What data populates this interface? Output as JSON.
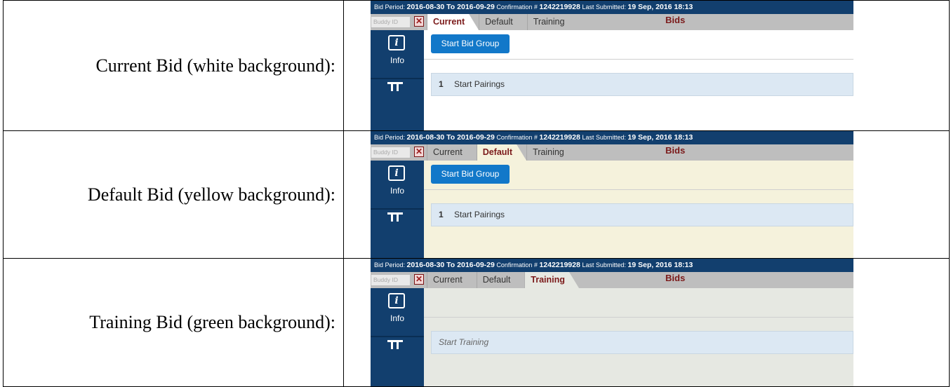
{
  "colors": {
    "header_bg": "#123f6e",
    "current_bg": "#ffffff",
    "default_bg": "#f5f2dc",
    "training_bg": "#e6e8e2",
    "button_blue": "#1278c9",
    "active_tab_text": "#7b1a1a"
  },
  "rows": [
    {
      "label": "Current Bid (white background):",
      "screenshot": {
        "bid_period_label": "Bid Period:",
        "bid_period_value": "2016-08-30 To 2016-09-29",
        "confirmation_label": "Confirmation #",
        "confirmation_value": "1242219928",
        "last_submitted_label": "Last Submitted:",
        "last_submitted_value": "19 Sep, 2016 18:13",
        "buddy_placeholder": "Buddy ID",
        "buddy_close": "✕",
        "tabs": [
          "Current",
          "Default",
          "Training"
        ],
        "active_tab": 0,
        "title": "Bids",
        "sidebar_icon": "info-icon",
        "sidebar_info_glyph": "i",
        "sidebar_info_label": "Info",
        "sidebar_icon2": "bid-list-icon",
        "button_label": "Start Bid Group",
        "list_number": "1",
        "list_text": "Start Pairings"
      }
    },
    {
      "label": "Default Bid (yellow background):",
      "screenshot": {
        "bid_period_label": "Bid Period:",
        "bid_period_value": "2016-08-30 To 2016-09-29",
        "confirmation_label": "Confirmation #",
        "confirmation_value": "1242219928",
        "last_submitted_label": "Last Submitted:",
        "last_submitted_value": "19 Sep, 2016 18:13",
        "buddy_placeholder": "Buddy ID",
        "buddy_close": "✕",
        "tabs": [
          "Current",
          "Default",
          "Training"
        ],
        "active_tab": 1,
        "title": "Bids",
        "sidebar_icon": "info-icon",
        "sidebar_info_glyph": "i",
        "sidebar_info_label": "Info",
        "sidebar_icon2": "bid-list-icon",
        "button_label": "Start Bid Group",
        "list_number": "1",
        "list_text": "Start Pairings"
      }
    },
    {
      "label": "Training Bid (green background):",
      "screenshot": {
        "bid_period_label": "Bid Period:",
        "bid_period_value": "2016-08-30 To 2016-09-29",
        "confirmation_label": "Confirmation #",
        "confirmation_value": "1242219928",
        "last_submitted_label": "Last Submitted:",
        "last_submitted_value": "19 Sep, 2016 18:13",
        "buddy_placeholder": "Buddy ID",
        "buddy_close": "✕",
        "tabs": [
          "Current",
          "Default",
          "Training"
        ],
        "active_tab": 2,
        "title": "Bids",
        "sidebar_icon": "info-icon",
        "sidebar_info_glyph": "i",
        "sidebar_info_label": "Info",
        "sidebar_icon2": "bid-list-icon",
        "list_text": "Start Training"
      }
    }
  ]
}
